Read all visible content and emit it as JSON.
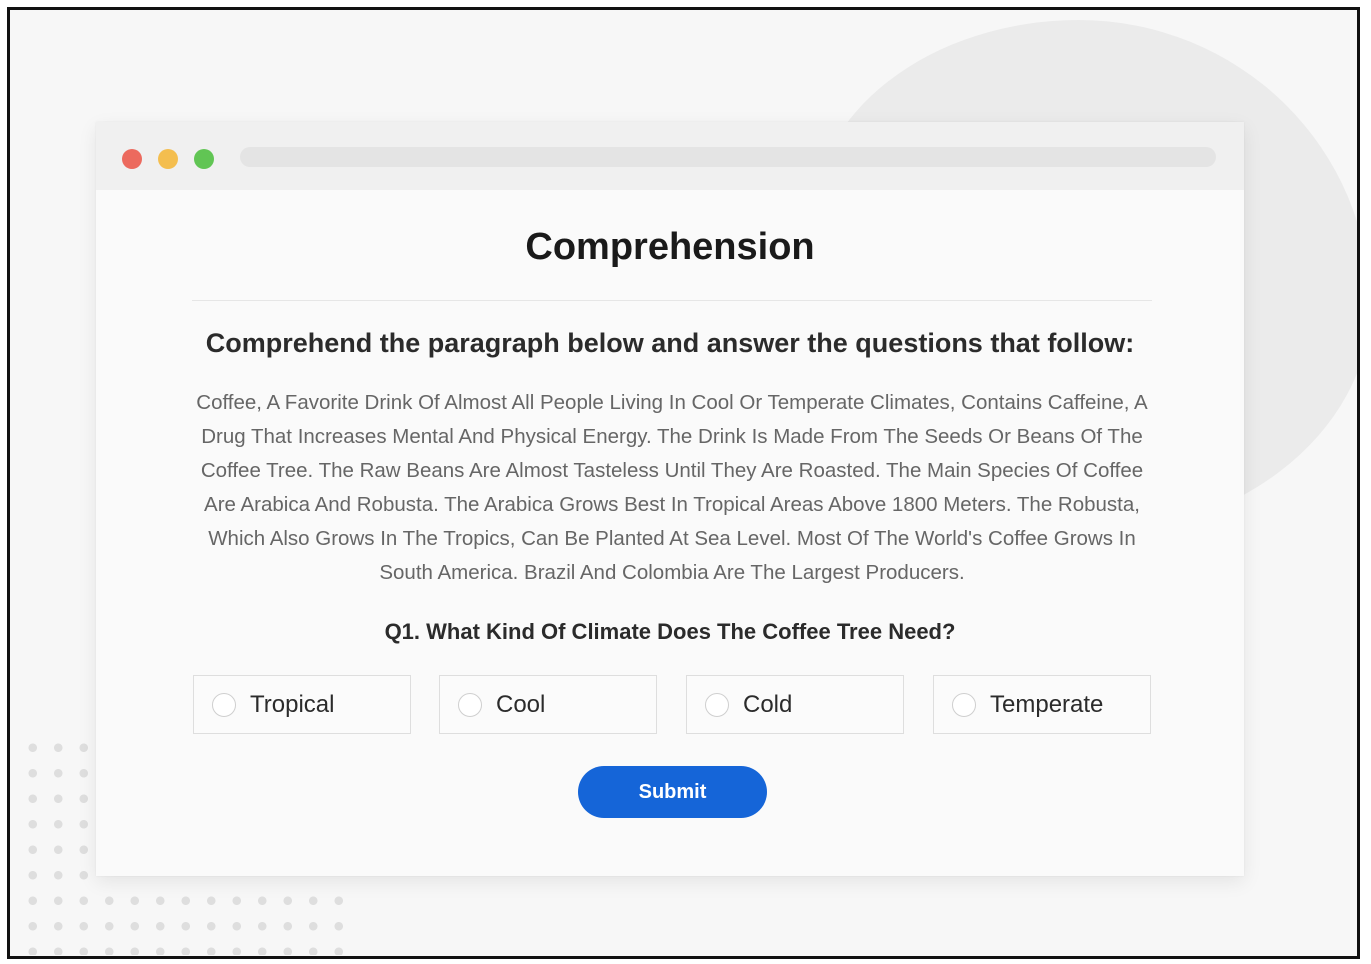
{
  "page": {
    "title": "Comprehension",
    "instructions": "Comprehend the paragraph below and answer the questions that follow:",
    "passage": "Coffee, A Favorite Drink Of Almost All People Living In Cool Or Temperate Climates, Contains Caffeine, A Drug That Increases Mental And Physical Energy. The Drink Is Made From The Seeds Or Beans Of The Coffee Tree. The Raw Beans Are Almost Tasteless Until They Are Roasted. The Main Species Of Coffee Are Arabica And Robusta. The Arabica Grows Best In Tropical Areas Above 1800 Meters. The Robusta, Which Also Grows In The Tropics, Can Be Planted At Sea Level. Most Of The World's Coffee Grows In South America. Brazil And Colombia Are The Largest Producers."
  },
  "question": {
    "text": "Q1. What Kind Of Climate Does The Coffee Tree Need?",
    "options": [
      {
        "label": "Tropical",
        "selected": false
      },
      {
        "label": "Cool",
        "selected": false
      },
      {
        "label": "Cold",
        "selected": false
      },
      {
        "label": "Temperate",
        "selected": false
      }
    ]
  },
  "actions": {
    "submit_label": "Submit"
  },
  "colors": {
    "accent": "#1565d8",
    "traffic_red": "#ec6a5e",
    "traffic_yellow": "#f4be4f",
    "traffic_green": "#61c554"
  }
}
